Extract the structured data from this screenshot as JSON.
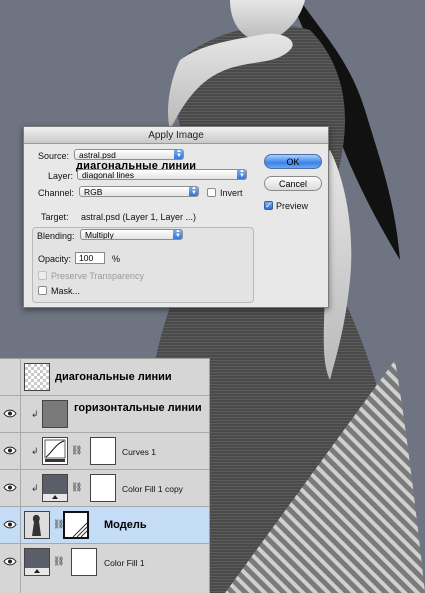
{
  "dialog": {
    "title": "Apply Image",
    "source_label": "Source:",
    "source_value": "astral.psd",
    "layer_label": "Layer:",
    "layer_value": "diagonal lines",
    "channel_label": "Channel:",
    "channel_value": "RGB",
    "invert_label": "Invert",
    "invert_checked": false,
    "target_label": "Target:",
    "target_value": "astral.psd (Layer 1, Layer ...)",
    "blending_label": "Blending:",
    "blending_value": "Multiply",
    "opacity_label": "Opacity:",
    "opacity_value": "100",
    "opacity_unit": "%",
    "preserve_transparency_label": "Preserve Transparency",
    "mask_label": "Mask...",
    "ok_label": "OK",
    "cancel_label": "Cancel",
    "preview_label": "Preview",
    "preview_checked": true
  },
  "overlay_caption": "диагональные линии",
  "layers": [
    {
      "name": "диагональные линии",
      "visible": false,
      "style": "big"
    },
    {
      "name": "горизонтальные линии",
      "visible": true,
      "style": "big",
      "clipped": true
    },
    {
      "name": "Curves 1",
      "visible": true,
      "style": "normal",
      "clipped": true
    },
    {
      "name": "Color Fill 1 copy",
      "visible": true,
      "style": "normal",
      "clipped": true
    },
    {
      "name": "Модель",
      "visible": true,
      "style": "big",
      "selected": true
    },
    {
      "name": "Color Fill 1",
      "visible": true,
      "style": "normal"
    }
  ],
  "colors": {
    "background": "#6f7482",
    "selected_row": "#c4dcf6",
    "ok_button": "#3a84e6"
  }
}
